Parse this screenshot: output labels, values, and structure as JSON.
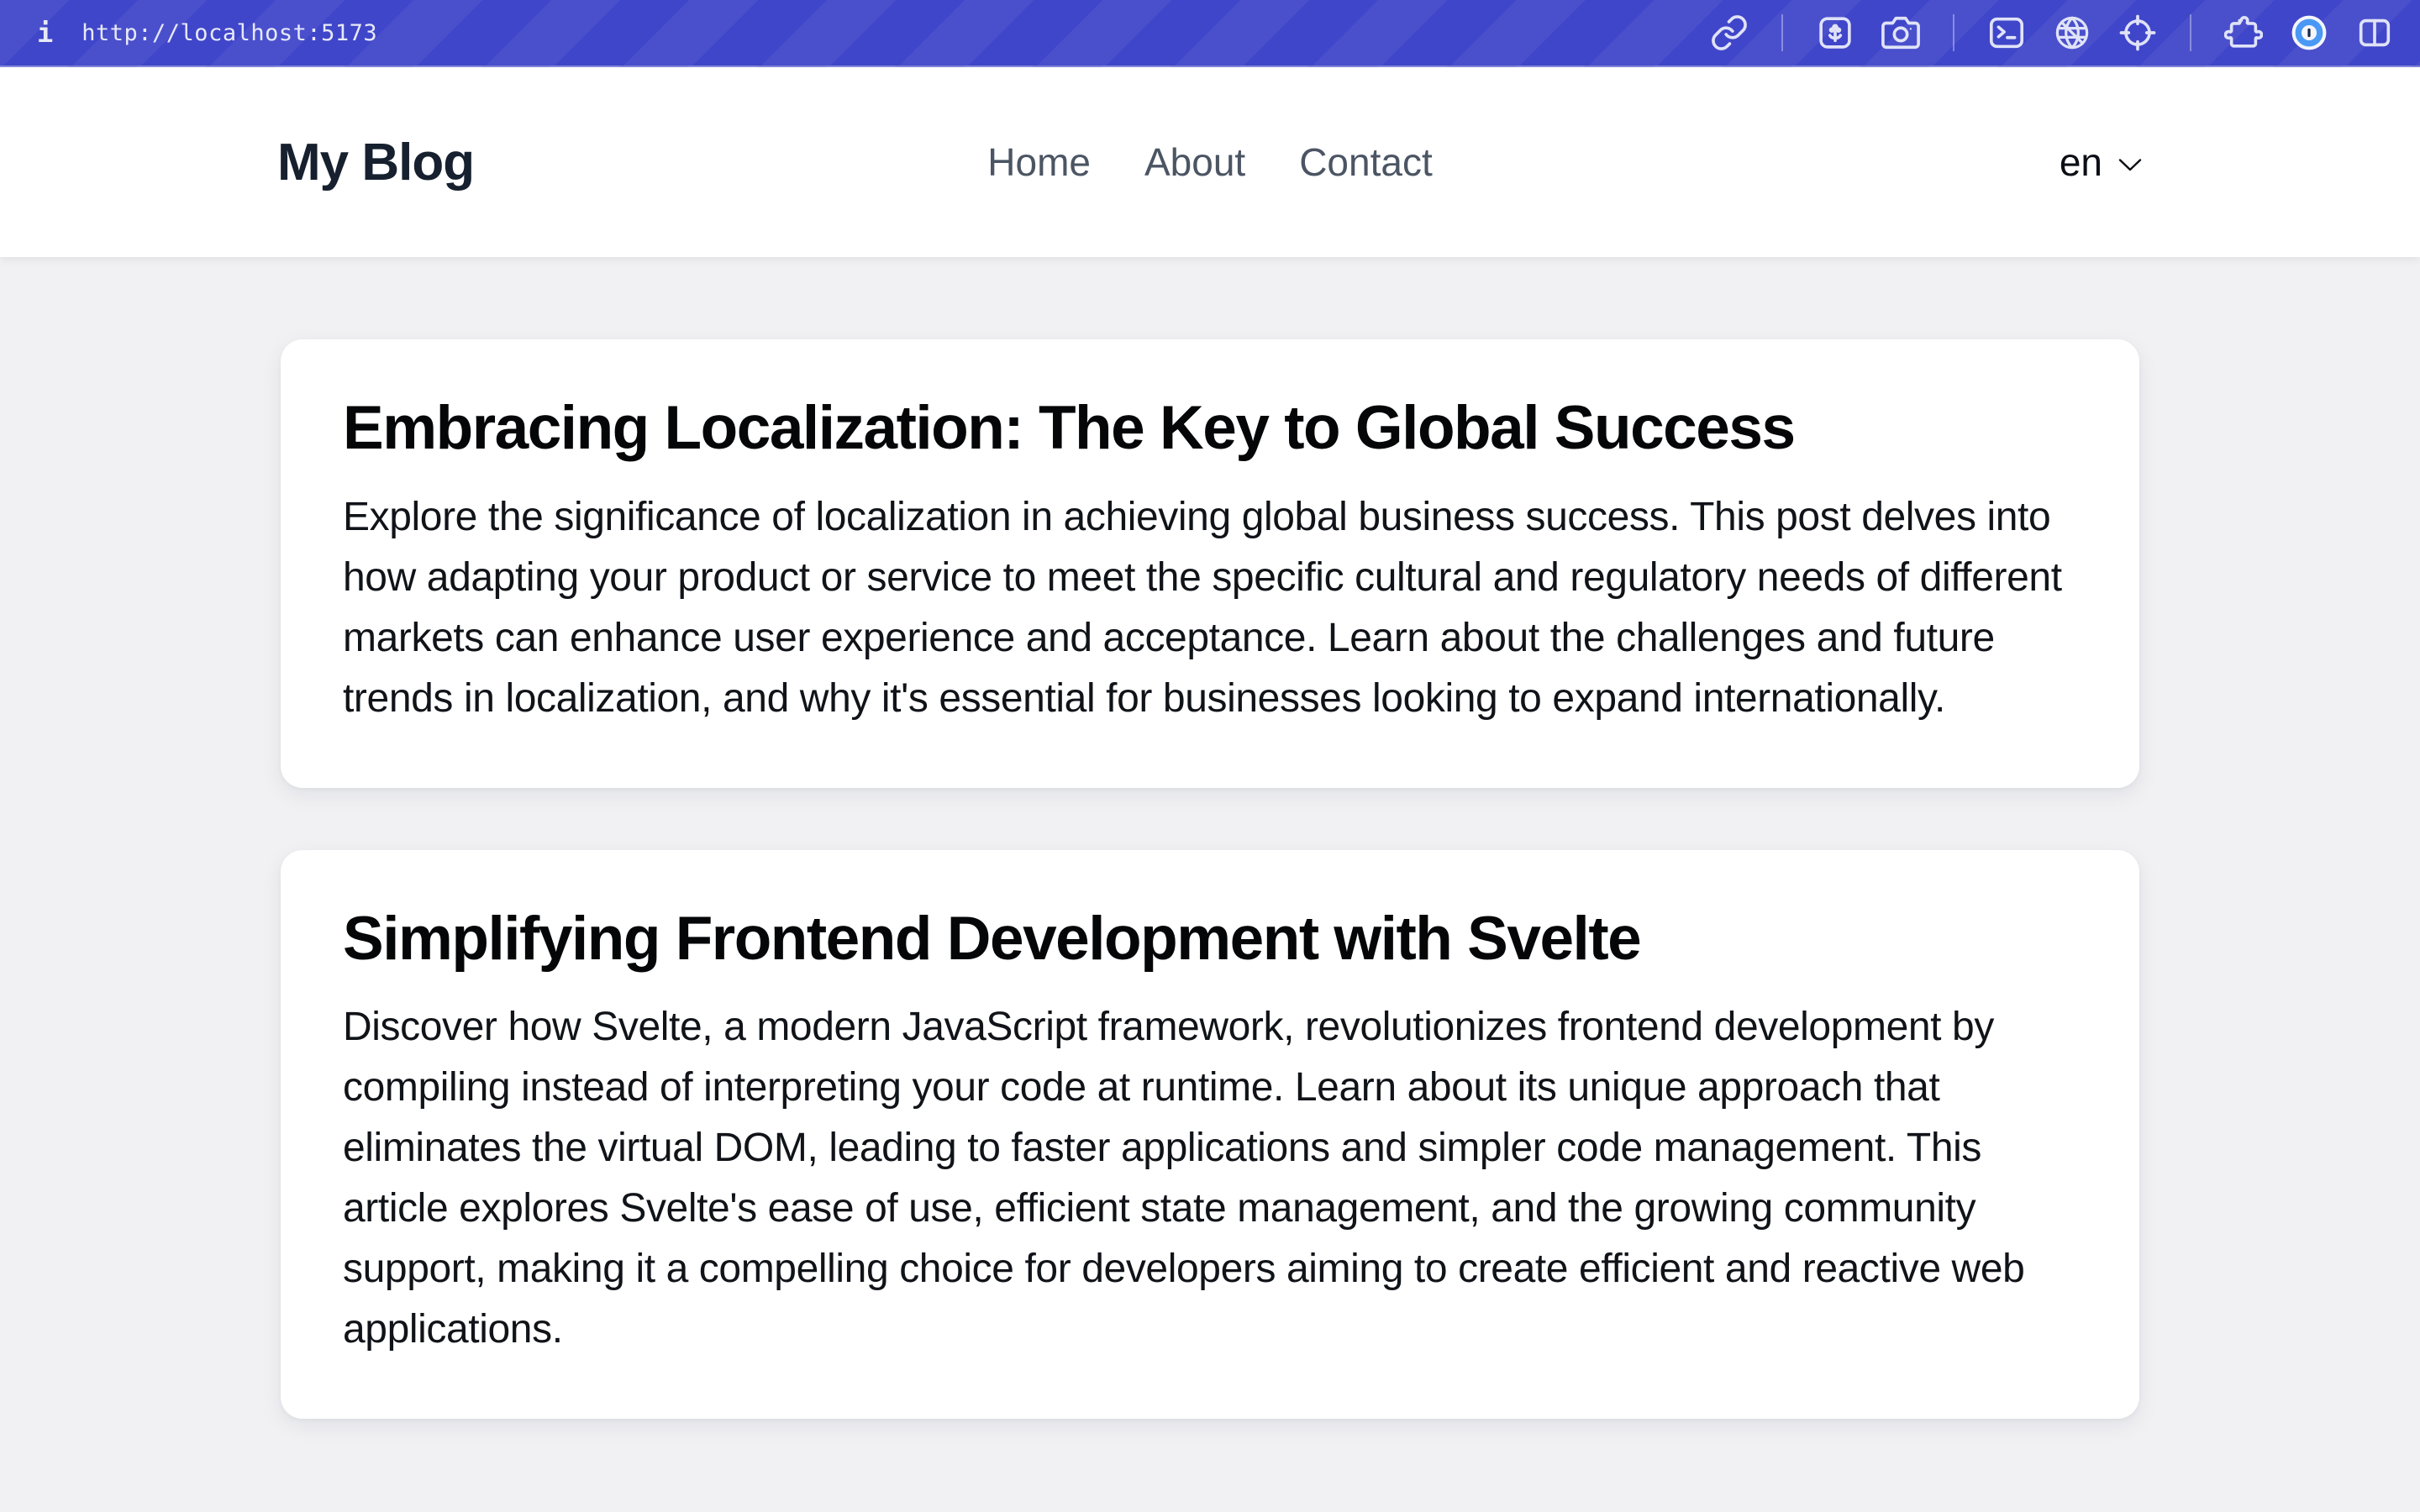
{
  "browser_bar": {
    "info_symbol": "i",
    "url": "http://localhost:5173",
    "icons": [
      "link",
      "flower-photo",
      "camera",
      "terminal",
      "globe",
      "crosshair",
      "puzzle-extension",
      "onepassword",
      "split-view"
    ]
  },
  "header": {
    "site_title": "My Blog",
    "nav_items": [
      {
        "label": "Home"
      },
      {
        "label": "About"
      },
      {
        "label": "Contact"
      }
    ],
    "language_selector": {
      "selected": "en"
    }
  },
  "posts": [
    {
      "title": "Embracing Localization: The Key to Global Success",
      "excerpt": "Explore the significance of localization in achieving global business success. This post delves into how adapting your product or service to meet the specific cultural and regulatory needs of different markets can enhance user experience and acceptance. Learn about the challenges and future trends in localization, and why it's essential for businesses looking to expand internationally."
    },
    {
      "title": "Simplifying Frontend Development with Svelte",
      "excerpt": "Discover how Svelte, a modern JavaScript framework, revolutionizes frontend development by compiling instead of interpreting your code at runtime. Learn about its unique approach that eliminates the virtual DOM, leading to faster applications and simpler code management. This article explores Svelte's ease of use, efficient state management, and the growing community support, making it a compelling choice for developers aiming to create efficient and reactive web applications."
    }
  ],
  "colors": {
    "toolbar_background": "#4046c9",
    "toolbar_icon": "#e9ebfb",
    "page_background": "#f1f1f4",
    "card_background": "#ffffff",
    "nav_link": "#4b5563",
    "title_text": "#16202e",
    "onepassword_blue": "#4a9df8",
    "onepassword_slot": "#13294b"
  }
}
